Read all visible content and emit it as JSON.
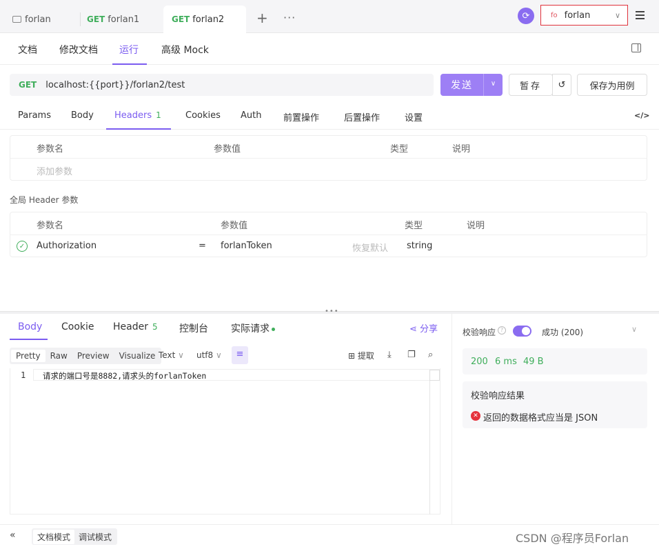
{
  "tabs": [
    {
      "label": "forlan",
      "method": ""
    },
    {
      "label": "forlan1",
      "method": "GET"
    },
    {
      "label": "forlan2",
      "method": "GET"
    }
  ],
  "env": {
    "prefix": "fo",
    "name": "forlan"
  },
  "nav": [
    "文档",
    "修改文档",
    "运行",
    "高级 Mock"
  ],
  "request": {
    "method": "GET",
    "url": "localhost:{{port}}/forlan2/test"
  },
  "buttons": {
    "send": "发送",
    "save": "暂存",
    "save_case": "保存为用例"
  },
  "param_tabs": {
    "params": "Params",
    "body": "Body",
    "headers": "Headers",
    "headers_count": "1",
    "cookies": "Cookies",
    "auth": "Auth",
    "pre": "前置操作",
    "post": "后置操作",
    "settings": "设置"
  },
  "table_headers": {
    "name": "参数名",
    "value": "参数值",
    "type": "类型",
    "desc": "说明"
  },
  "add_param_placeholder": "添加参数",
  "global_header_label": "全局 Header 参数",
  "global_row": {
    "name": "Authorization",
    "op": "=",
    "value": "forlanToken",
    "restore": "恢复默认",
    "type": "string"
  },
  "response_tabs": {
    "body": "Body",
    "cookie": "Cookie",
    "header": "Header",
    "header_count": "5",
    "console": "控制台",
    "actual": "实际请求"
  },
  "share": "分享",
  "format_tabs": [
    "Pretty",
    "Raw",
    "Preview",
    "Visualize"
  ],
  "format_type": "Text",
  "encoding": "utf8",
  "extract": "提取",
  "editor": {
    "line": "1",
    "code": "请求的端口号是8882,请求头的forlanToken"
  },
  "validate": {
    "label": "校验响应",
    "result": "成功 (200)"
  },
  "stats": {
    "status": "200",
    "time": "6 ms",
    "size": "49 B"
  },
  "result_title": "校验响应结果",
  "error_text": "返回的数据格式应当是 JSON",
  "footer": {
    "doc_mode": "文档模式",
    "debug_mode": "调试模式",
    "watermark": "CSDN @程序员Forlan"
  },
  "colors": {
    "accent": "#7b5cf0",
    "get": "#3fae5b",
    "error": "#e5333d"
  }
}
